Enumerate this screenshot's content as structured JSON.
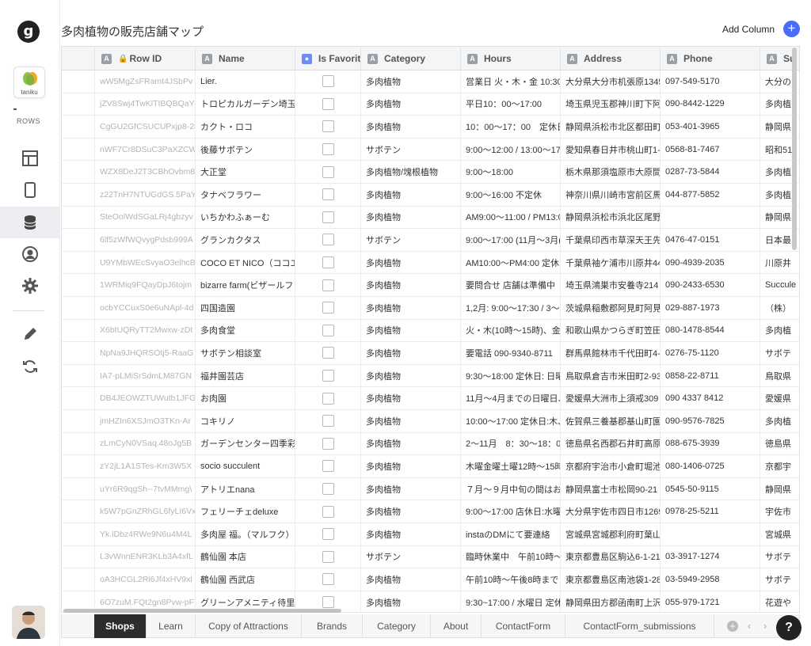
{
  "page_title": "多肉植物の販売店舗マップ",
  "add_column_label": "Add Column",
  "rail": {
    "app_badge": "g",
    "app_thumb_text": "taniku",
    "rows_label": "ROWS"
  },
  "columns": [
    {
      "tag": "A",
      "label": "Row ID"
    },
    {
      "tag": "",
      "label": "Name"
    },
    {
      "tag": "",
      "label": "Is Favorite"
    },
    {
      "tag": "A",
      "label": "Category"
    },
    {
      "tag": "A",
      "label": "Hours"
    },
    {
      "tag": "A",
      "label": "Address"
    },
    {
      "tag": "A",
      "label": "Phone"
    },
    {
      "tag": "A",
      "label": "Su"
    }
  ],
  "rows": [
    {
      "id": "wW5MgZsFRamt4JSbPv",
      "name": "Lier.",
      "category": "多肉植物",
      "hours": "営業日 火・木・金 10:30",
      "address": "大分県大分市机張原1345",
      "phone": "097-549-5170",
      "extra": "大分の"
    },
    {
      "id": "jZV8Swj4TwKlTIBQBQaY",
      "name": "トロピカルガーデン埼玉",
      "category": "多肉植物",
      "hours": "平日10：00〜17:00",
      "address": "埼玉県児玉郡神川町下阿",
      "phone": "090-8442-1229",
      "extra": "多肉植"
    },
    {
      "id": "CgGU2GfCSUCUPxjp8-28",
      "name": "カクト・ロコ",
      "category": "多肉植物",
      "hours": "10：00〜17：00　定休日",
      "address": "静岡県浜松市北区都田町",
      "phone": "053-401-3965",
      "extra": "静岡県"
    },
    {
      "id": "nWF7Cr8DSuC3PaXZCW",
      "name": "後藤サボテン",
      "category": "サボテン",
      "hours": "9:00〜12:00 / 13:00〜17",
      "address": "愛知県春日井市桃山町1-",
      "phone": "0568-81-7467",
      "extra": "昭和51"
    },
    {
      "id": "WZX8DeJ2T3CBhOvbm8",
      "name": "大正堂",
      "category": "多肉植物/塊根植物",
      "hours": "9:00〜18:00",
      "address": "栃木県那須塩原市大原間",
      "phone": "0287-73-5844",
      "extra": "多肉植"
    },
    {
      "id": "z22TnH7NTUGdGS.5PaY",
      "name": "タナベフラワー",
      "category": "多肉植物",
      "hours": "9:00〜16:00 不定休",
      "address": "神奈川県川崎市宮前区馬",
      "phone": "044-877-5852",
      "extra": "多肉植"
    },
    {
      "id": "SteOolWdSGaLRj4gbzyv",
      "name": "いちかわふぁーむ",
      "category": "多肉植物",
      "hours": "AM9:00〜11:00 / PM13:0",
      "address": "静岡県浜松市浜北区尾野",
      "phone": "",
      "extra": "静岡県"
    },
    {
      "id": "6lf5zWfWQvygPdsb999A",
      "name": "グランカクタス",
      "category": "サボテン",
      "hours": "9:00〜17:00 (11月〜3月(",
      "address": "千葉県印西市草深天王先",
      "phone": "0476-47-0151",
      "extra": "日本最"
    },
    {
      "id": "U9YMbWEcSvyaO3elhcB",
      "name": "COCO ET NICO（ココエ",
      "category": "多肉植物",
      "hours": "AM10:00〜PM4:00 定休",
      "address": "千葉県袖ケ浦市川原井44",
      "phone": "090-4939-2035",
      "extra": "川原井"
    },
    {
      "id": "1WRMiq9FQayDpJ6tojm",
      "name": "bizarre farm(ビザールフ",
      "category": "多肉植物",
      "hours": "要問合せ 店舗は準備中",
      "address": "埼玉県鴻巣市安養寺214",
      "phone": "090-2433-6530",
      "extra": "Succule"
    },
    {
      "id": "ocbYCCuxS0e6uNApl-4d",
      "name": "四国造園",
      "category": "多肉植物",
      "hours": "1,2月: 9:00〜17:30 / 3〜",
      "address": "茨城県稲敷郡阿見町阿見",
      "phone": "029-887-1973",
      "extra": "（株）"
    },
    {
      "id": "X6btUQRyTT2Mwxw-zDt",
      "name": "多肉食堂",
      "category": "多肉植物",
      "hours": "火・木(10時〜15時)、金",
      "address": "和歌山県かつらぎ町笠田",
      "phone": "080-1478-8544",
      "extra": "多肉植"
    },
    {
      "id": "NpNa9JHQRSOtj5-RaaG",
      "name": "サボテン相談室",
      "category": "多肉植物",
      "hours": "要電話 090-9340-8711",
      "address": "群馬県館林市千代田町4-",
      "phone": "0276-75-1120",
      "extra": "サボテ"
    },
    {
      "id": "IA7-pLMiSrSdmLM87GN",
      "name": "福井園芸店",
      "category": "多肉植物",
      "hours": "9:30〜18:00 定休日: 日曜",
      "address": "鳥取県倉吉市米田町2-93",
      "phone": "0858-22-8711",
      "extra": "鳥取県"
    },
    {
      "id": "DB4JEOWZTUWutb1JFG",
      "name": "お肉園",
      "category": "多肉植物",
      "hours": "11月〜4月までの日曜日、",
      "address": "愛媛県大洲市上須戒309",
      "phone": "090 4337 8412",
      "extra": "愛媛県"
    },
    {
      "id": "jmHZIn6XSJmO3TKn-Ar",
      "name": "コキリノ",
      "category": "多肉植物",
      "hours": "10:00〜17:00 定休日:木、",
      "address": "佐賀県三養基郡基山町園",
      "phone": "090-9576-7825",
      "extra": "多肉植"
    },
    {
      "id": "zLmCyN0VSaq.48oJg5B",
      "name": "ガーデンセンター四季彩",
      "category": "多肉植物",
      "hours": "2〜11月　8：30〜18：0",
      "address": "徳島県名西郡石井町高原",
      "phone": "088-675-3939",
      "extra": "徳島県"
    },
    {
      "id": "zY2jL1A1STes-Km3W5X",
      "name": "socio succulent",
      "category": "多肉植物",
      "hours": "木曜金曜土曜12時〜15時",
      "address": "京都府宇治市小倉町堀池",
      "phone": "080-1406-0725",
      "extra": "京都宇"
    },
    {
      "id": "uYr6R9qgSh--7tvMMmg\\",
      "name": "アトリエnana",
      "category": "多肉植物",
      "hours": "７月〜９月中旬の間はお",
      "address": "静岡県富士市松岡90-21",
      "phone": "0545-50-9115",
      "extra": "静岡県"
    },
    {
      "id": "k5W7pGnZRhGL6fyLI6Vx",
      "name": "フェリーチェdeluxe",
      "category": "多肉植物",
      "hours": "9:00〜17:00 店休日:水曜",
      "address": "大分県宇佐市四日市1269",
      "phone": "0978-25-5211",
      "extra": "宇佐市"
    },
    {
      "id": "Yk.lDbz4RWe9N6u4M4L",
      "name": "多肉屋 福。（マルフク）",
      "category": "多肉植物",
      "hours": "instaのDMにて要連絡",
      "address": "宮城県宮城郡利府町葉山",
      "phone": "",
      "extra": "宮城県"
    },
    {
      "id": "L3vWnnENR3KLb3A4xfL",
      "name": "鶴仙園 本店",
      "category": "サボテン",
      "hours": "臨時休業中　午前10時〜",
      "address": "東京都豊島区駒込6-1-21",
      "phone": "03-3917-1274",
      "extra": "サボテ"
    },
    {
      "id": "oA3HCGL2Rl6Jf4xHV9xl",
      "name": "鶴仙園 西武店",
      "category": "多肉植物",
      "hours": "午前10時〜午後8時まで",
      "address": "東京都豊島区南池袋1-28",
      "phone": "03-5949-2958",
      "extra": "サボテ"
    },
    {
      "id": "6O7zuM.FQt2gn8Pvw-pF",
      "name": "グリーンアメニティ待里",
      "category": "多肉植物",
      "hours": "9:30~17:00 / 水曜日 定休",
      "address": "静岡県田方郡函南町上沢",
      "phone": "055-979-1721",
      "extra": "花遊や"
    }
  ],
  "tabs": [
    "Shops",
    "Learn",
    "Copy of Attractions",
    "Brands",
    "Category",
    "About",
    "ContactForm",
    "ContactForm_submissions"
  ],
  "help_label": "?",
  "colors": {
    "accent": "#4a6cf7",
    "active_tab": "#2c2c2c"
  }
}
